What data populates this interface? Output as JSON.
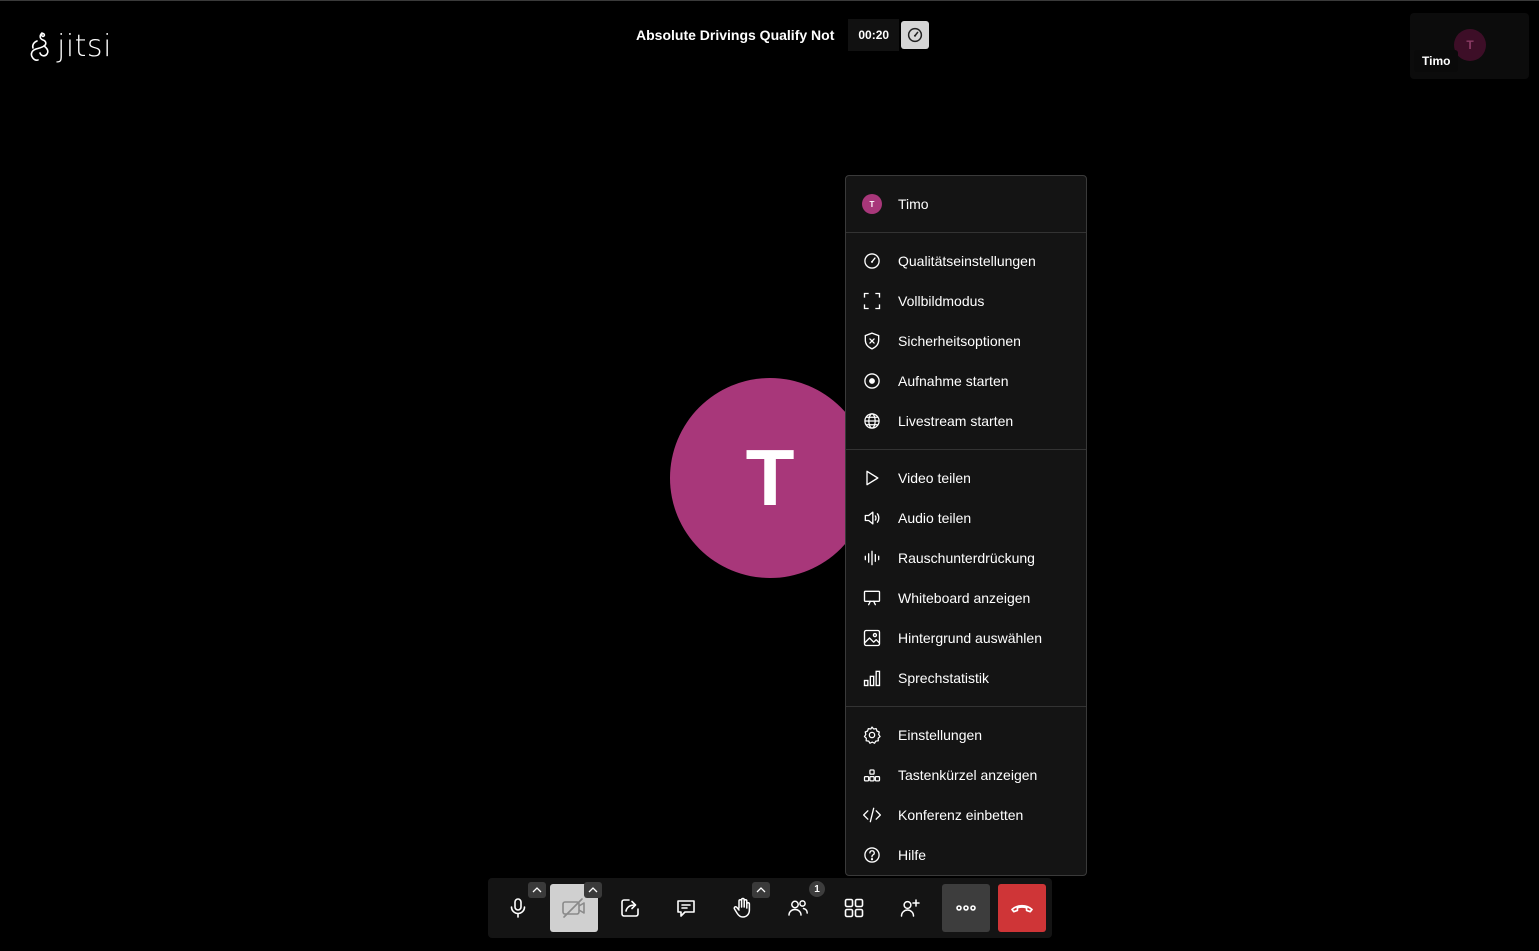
{
  "app": {
    "logo_text": "jitsi"
  },
  "header": {
    "conference_name": "Absolute Drivings Qualify Not",
    "timer": "00:20"
  },
  "filmstrip": {
    "participant_name": "Timo",
    "avatar_initial": "T"
  },
  "stage": {
    "avatar_initial": "T",
    "avatar_color": "#a8377a"
  },
  "menu": {
    "profile": {
      "name": "Timo",
      "initial": "T"
    },
    "items": [
      {
        "label": "Qualitätseinstellungen",
        "icon": "speedometer-icon"
      },
      {
        "label": "Vollbildmodus",
        "icon": "fullscreen-icon"
      },
      {
        "label": "Sicherheitsoptionen",
        "icon": "shield-icon"
      },
      {
        "label": "Aufnahme starten",
        "icon": "record-icon"
      },
      {
        "label": "Livestream starten",
        "icon": "globe-icon"
      },
      {
        "label": "Video teilen",
        "icon": "play-icon"
      },
      {
        "label": "Audio teilen",
        "icon": "speaker-icon"
      },
      {
        "label": "Rauschunterdrückung",
        "icon": "noise-suppression-icon"
      },
      {
        "label": "Whiteboard anzeigen",
        "icon": "whiteboard-icon"
      },
      {
        "label": "Hintergrund auswählen",
        "icon": "image-icon"
      },
      {
        "label": "Sprechstatistik",
        "icon": "bar-chart-icon"
      },
      {
        "label": "Einstellungen",
        "icon": "gear-icon"
      },
      {
        "label": "Tastenkürzel anzeigen",
        "icon": "shortcuts-icon"
      },
      {
        "label": "Konferenz einbetten",
        "icon": "code-icon"
      },
      {
        "label": "Hilfe",
        "icon": "help-icon"
      }
    ]
  },
  "toolbar": {
    "participants_count": "1",
    "buttons": [
      "microphone-icon",
      "camera-off-icon",
      "share-screen-icon",
      "chat-icon",
      "raise-hand-icon",
      "participants-icon",
      "tile-view-icon",
      "invite-icon",
      "more-icon",
      "hangup-icon"
    ],
    "hangup_color": "#cf3537"
  }
}
